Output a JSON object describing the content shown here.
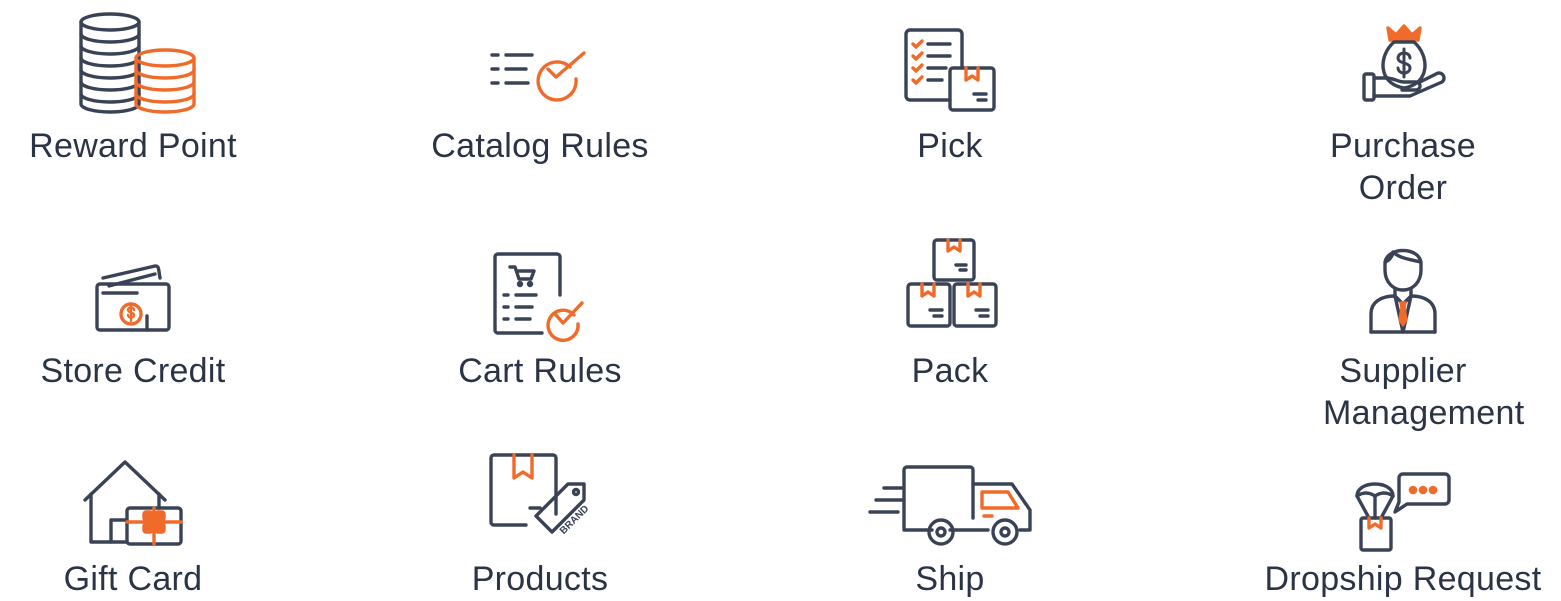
{
  "colors": {
    "icon_dark": "#3a4356",
    "icon_accent": "#f06a2a",
    "text": "#2b3445",
    "background": "#ffffff"
  },
  "features": [
    {
      "label": "Reward Point",
      "icon": "coin-stacks-icon"
    },
    {
      "label": "Catalog Rules",
      "icon": "checklist-check-icon"
    },
    {
      "label": "Pick",
      "icon": "pick-list-box-icon"
    },
    {
      "label": "Purchase Order",
      "icon": "money-bag-hand-icon"
    },
    {
      "label": "Store Credit",
      "icon": "credit-cards-icon"
    },
    {
      "label": "Cart Rules",
      "icon": "cart-document-check-icon"
    },
    {
      "label": "Pack",
      "icon": "stacked-boxes-icon"
    },
    {
      "label": "Supplier Management",
      "icon": "supplier-person-icon"
    },
    {
      "label": "Gift Card",
      "icon": "house-gift-card-icon"
    },
    {
      "label": "Products",
      "icon": "box-brand-tag-icon"
    },
    {
      "label": "Ship",
      "icon": "delivery-truck-icon"
    },
    {
      "label": "Dropship Request",
      "icon": "parachute-box-chat-icon"
    }
  ]
}
